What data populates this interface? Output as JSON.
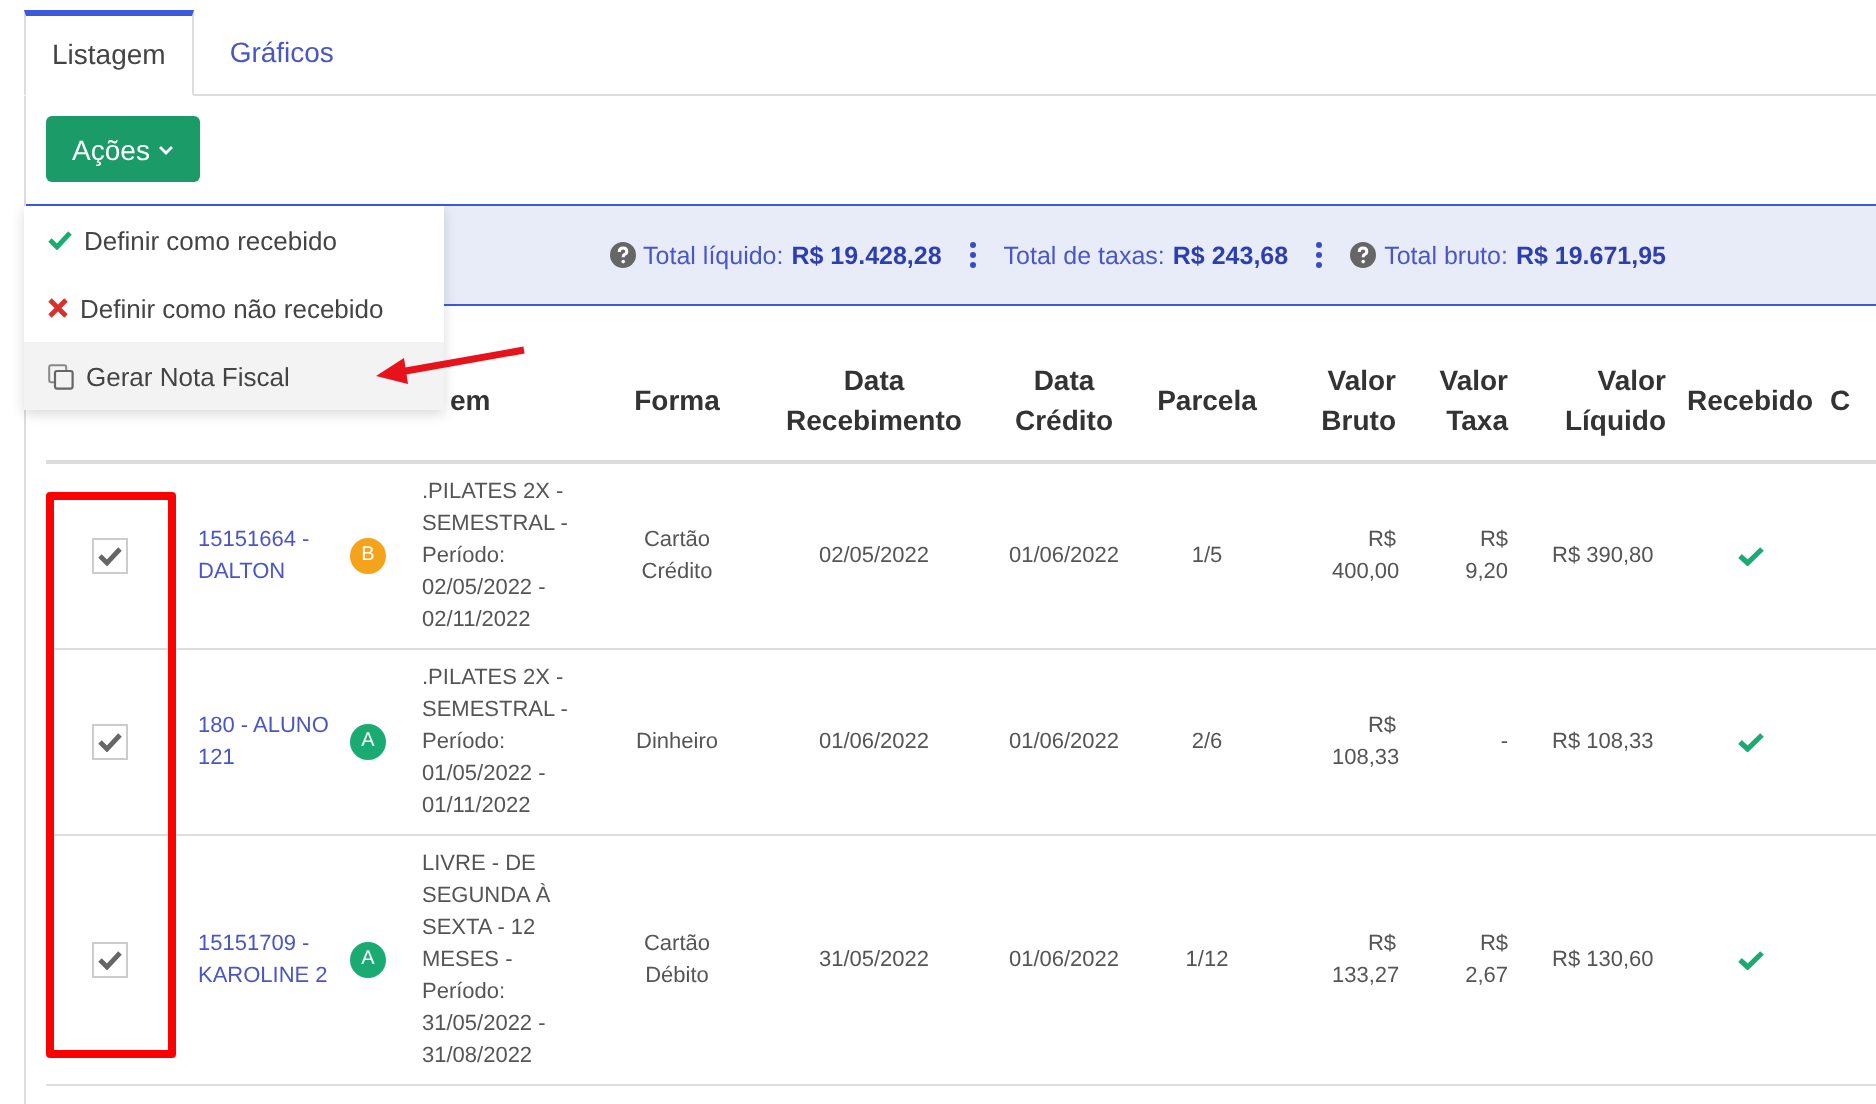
{
  "tabs": [
    {
      "label": "Listagem",
      "selected": true
    },
    {
      "label": "Gráficos",
      "selected": false
    }
  ],
  "actions_button": {
    "label": "Ações"
  },
  "actions_menu": {
    "items": [
      {
        "kind": "check",
        "label": "Definir como recebido",
        "highlighted": false
      },
      {
        "kind": "cross",
        "label": "Definir como não recebido",
        "highlighted": false
      },
      {
        "kind": "copy",
        "label": "Gerar Nota Fiscal",
        "highlighted": true
      }
    ]
  },
  "totals": [
    {
      "help": true,
      "label": "Total líquido:",
      "value": "R$ 19.428,28"
    },
    {
      "help": false,
      "label": "Total de taxas:",
      "value": "R$ 243,68"
    },
    {
      "help": true,
      "label": "Total bruto:",
      "value": "R$ 19.671,95"
    }
  ],
  "table": {
    "columns": [
      "em",
      "Forma",
      "Data Recebimento",
      "Data Crédito",
      "Parcela",
      "Valor Bruto",
      "Valor Taxa",
      "Valor Líquido",
      "Recebido",
      "C"
    ],
    "rows": [
      {
        "checked": true,
        "student": "15151664 - DALTON",
        "badge": {
          "letter": "B",
          "color": "#f5a31a"
        },
        "item": ".PILATES 2X - SEMESTRAL - Período: 02/05/2022 - 02/11/2022",
        "form": "Cartão Crédito",
        "receipt_date": "02/05/2022",
        "credit_date": "01/06/2022",
        "installment": "1/5",
        "gross": "R$ 400,00",
        "fee": "R$ 9,20",
        "net": "R$ 390,80",
        "received": true
      },
      {
        "checked": true,
        "student": "180 - ALUNO 121",
        "badge": {
          "letter": "A",
          "color": "#1aab73"
        },
        "item": ".PILATES 2X - SEMESTRAL - Período: 01/05/2022 - 01/11/2022",
        "form": "Dinheiro",
        "receipt_date": "01/06/2022",
        "credit_date": "01/06/2022",
        "installment": "2/6",
        "gross": "R$ 108,33",
        "fee": "-",
        "net": "R$ 108,33",
        "received": true
      },
      {
        "checked": true,
        "student": "15151709 - KAROLINE 2",
        "badge": {
          "letter": "A",
          "color": "#1aab73"
        },
        "item": "LIVRE - DE SEGUNDA À SEXTA - 12 MESES - Período: 31/05/2022 - 31/08/2022",
        "form": "Cartão Débito",
        "receipt_date": "31/05/2022",
        "credit_date": "01/06/2022",
        "installment": "1/12",
        "gross": "R$ 133,27",
        "fee": "R$ 2,67",
        "net": "R$ 130,60",
        "received": true
      }
    ]
  }
}
